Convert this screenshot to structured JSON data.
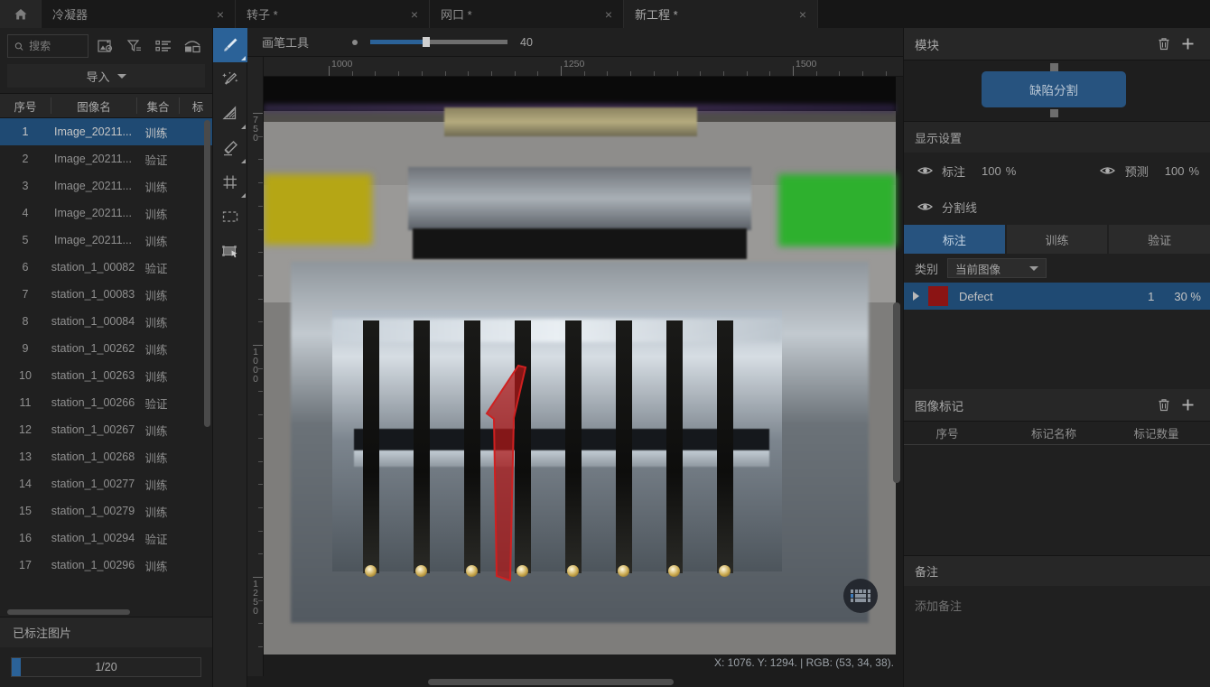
{
  "tabs": [
    {
      "label": "冷凝器",
      "close": "×",
      "active": false
    },
    {
      "label": "转子 *",
      "close": "×",
      "active": false
    },
    {
      "label": "网口 *",
      "close": "×",
      "active": false
    },
    {
      "label": "新工程 *",
      "close": "×",
      "active": true
    }
  ],
  "left": {
    "search_placeholder": "搜索",
    "search_value": "",
    "icons": [
      "image-settings-icon",
      "filter-icon",
      "list-icon",
      "compare-icon"
    ],
    "import_label": "导入",
    "columns": [
      "序号",
      "图像名",
      "集合",
      "标"
    ],
    "rows": [
      {
        "idx": "1",
        "name": "Image_20211...",
        "set": "训练",
        "mark": "",
        "selected": true
      },
      {
        "idx": "2",
        "name": "Image_20211...",
        "set": "验证",
        "mark": "",
        "selected": false
      },
      {
        "idx": "3",
        "name": "Image_20211...",
        "set": "训练",
        "mark": "",
        "selected": false
      },
      {
        "idx": "4",
        "name": "Image_20211...",
        "set": "训练",
        "mark": "",
        "selected": false
      },
      {
        "idx": "5",
        "name": "Image_20211...",
        "set": "训练",
        "mark": "",
        "selected": false
      },
      {
        "idx": "6",
        "name": "station_1_00082",
        "set": "验证",
        "mark": "",
        "selected": false
      },
      {
        "idx": "7",
        "name": "station_1_00083",
        "set": "训练",
        "mark": "",
        "selected": false
      },
      {
        "idx": "8",
        "name": "station_1_00084",
        "set": "训练",
        "mark": "",
        "selected": false
      },
      {
        "idx": "9",
        "name": "station_1_00262",
        "set": "训练",
        "mark": "",
        "selected": false
      },
      {
        "idx": "10",
        "name": "station_1_00263",
        "set": "训练",
        "mark": "",
        "selected": false
      },
      {
        "idx": "11",
        "name": "station_1_00266",
        "set": "验证",
        "mark": "",
        "selected": false
      },
      {
        "idx": "12",
        "name": "station_1_00267",
        "set": "训练",
        "mark": "",
        "selected": false
      },
      {
        "idx": "13",
        "name": "station_1_00268",
        "set": "训练",
        "mark": "",
        "selected": false
      },
      {
        "idx": "14",
        "name": "station_1_00277",
        "set": "训练",
        "mark": "",
        "selected": false
      },
      {
        "idx": "15",
        "name": "station_1_00279",
        "set": "训练",
        "mark": "",
        "selected": false
      },
      {
        "idx": "16",
        "name": "station_1_00294",
        "set": "验证",
        "mark": "",
        "selected": false
      },
      {
        "idx": "17",
        "name": "station_1_00296",
        "set": "训练",
        "mark": "",
        "selected": false
      }
    ],
    "labeled_title": "已标注图片",
    "progress_text": "1/20",
    "progress_percent": 5
  },
  "tools": [
    {
      "name": "brush-tool",
      "active": true
    },
    {
      "name": "magic-wand-tool",
      "active": false
    },
    {
      "name": "fill-shape-tool",
      "active": false
    },
    {
      "name": "eraser-tool",
      "active": false
    },
    {
      "name": "grid-tool",
      "active": false
    },
    {
      "name": "marquee-tool",
      "active": false
    },
    {
      "name": "transform-tool",
      "active": false
    }
  ],
  "canvas_toolbar": {
    "title": "画笔工具",
    "brush_size": "40"
  },
  "rulers": {
    "horizontal_labels": [
      "1000",
      "1250",
      "1500"
    ],
    "vertical_labels": [
      "750",
      "1000",
      "1250"
    ]
  },
  "status": "X: 1076. Y: 1294. | RGB: (53, 34, 38).",
  "right": {
    "module": {
      "title": "模块",
      "node_label": "缺陷分割"
    },
    "display": {
      "title": "显示设置",
      "annotation_label": "标注",
      "annotation_value": "100",
      "annotation_unit": "%",
      "prediction_label": "预测",
      "prediction_value": "100",
      "prediction_unit": "%",
      "segline_label": "分割线"
    },
    "segtabs": [
      {
        "label": "标注",
        "on": true
      },
      {
        "label": "训练",
        "on": false
      },
      {
        "label": "验证",
        "on": false
      }
    ],
    "category": {
      "label": "类别",
      "selected": "当前图像"
    },
    "defects": [
      {
        "name": "Defect",
        "count": "1",
        "percent": "30 %",
        "color": "#8b1414",
        "selected": true
      }
    ],
    "marks": {
      "title": "图像标记",
      "columns": [
        "序号",
        "标记名称",
        "标记数量"
      ],
      "rows": []
    },
    "note": {
      "title": "备注",
      "placeholder": "添加备注"
    }
  },
  "colors": {
    "accent": "#2b6298",
    "selection": "#1f4a73",
    "node": "#27537f",
    "defect": "#8b1414",
    "panel_bg": "#202020"
  }
}
